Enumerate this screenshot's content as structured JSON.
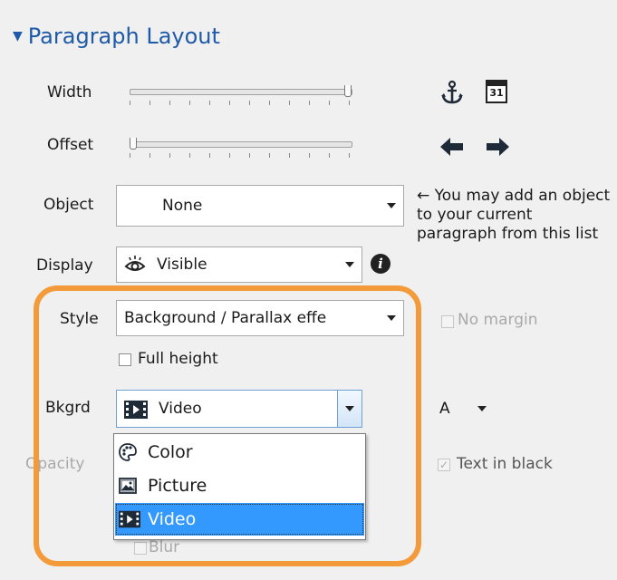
{
  "section": {
    "title": "Paragraph Layout"
  },
  "width_slider": {
    "label": "Width",
    "value": 1.0
  },
  "offset_slider": {
    "label": "Offset",
    "value": 0.0
  },
  "icons": {
    "anchor": "anchor-icon",
    "calendar": "calendar-icon",
    "calendar_day": "31",
    "left": "arrow-left-icon",
    "right": "arrow-right-icon",
    "info": "info-icon"
  },
  "object": {
    "label": "Object",
    "value": "None",
    "note_arrow": "←",
    "note": "You may add an object to your current paragraph from this list"
  },
  "display": {
    "label": "Display",
    "value": "Visible"
  },
  "style": {
    "label": "Style",
    "value": "Background / Parallax effe",
    "no_margin_label": "No margin"
  },
  "full_height": {
    "label": "Full height",
    "checked": false
  },
  "bkgrd": {
    "label": "Bkgrd",
    "value": "Video",
    "options": [
      {
        "label": "Color",
        "icon": "palette-icon"
      },
      {
        "label": "Picture",
        "icon": "picture-icon"
      },
      {
        "label": "Video",
        "icon": "film-icon",
        "selected": true
      }
    ]
  },
  "align_combo": {
    "value": "A"
  },
  "opacity": {
    "label": "Opacity"
  },
  "text_in_black": {
    "label": "Text in black",
    "checked": true
  },
  "blur": {
    "label": "Blur"
  },
  "colors": {
    "accent": "#1e5aa8",
    "highlight": "#f39a3a",
    "selection": "#3399ff"
  }
}
